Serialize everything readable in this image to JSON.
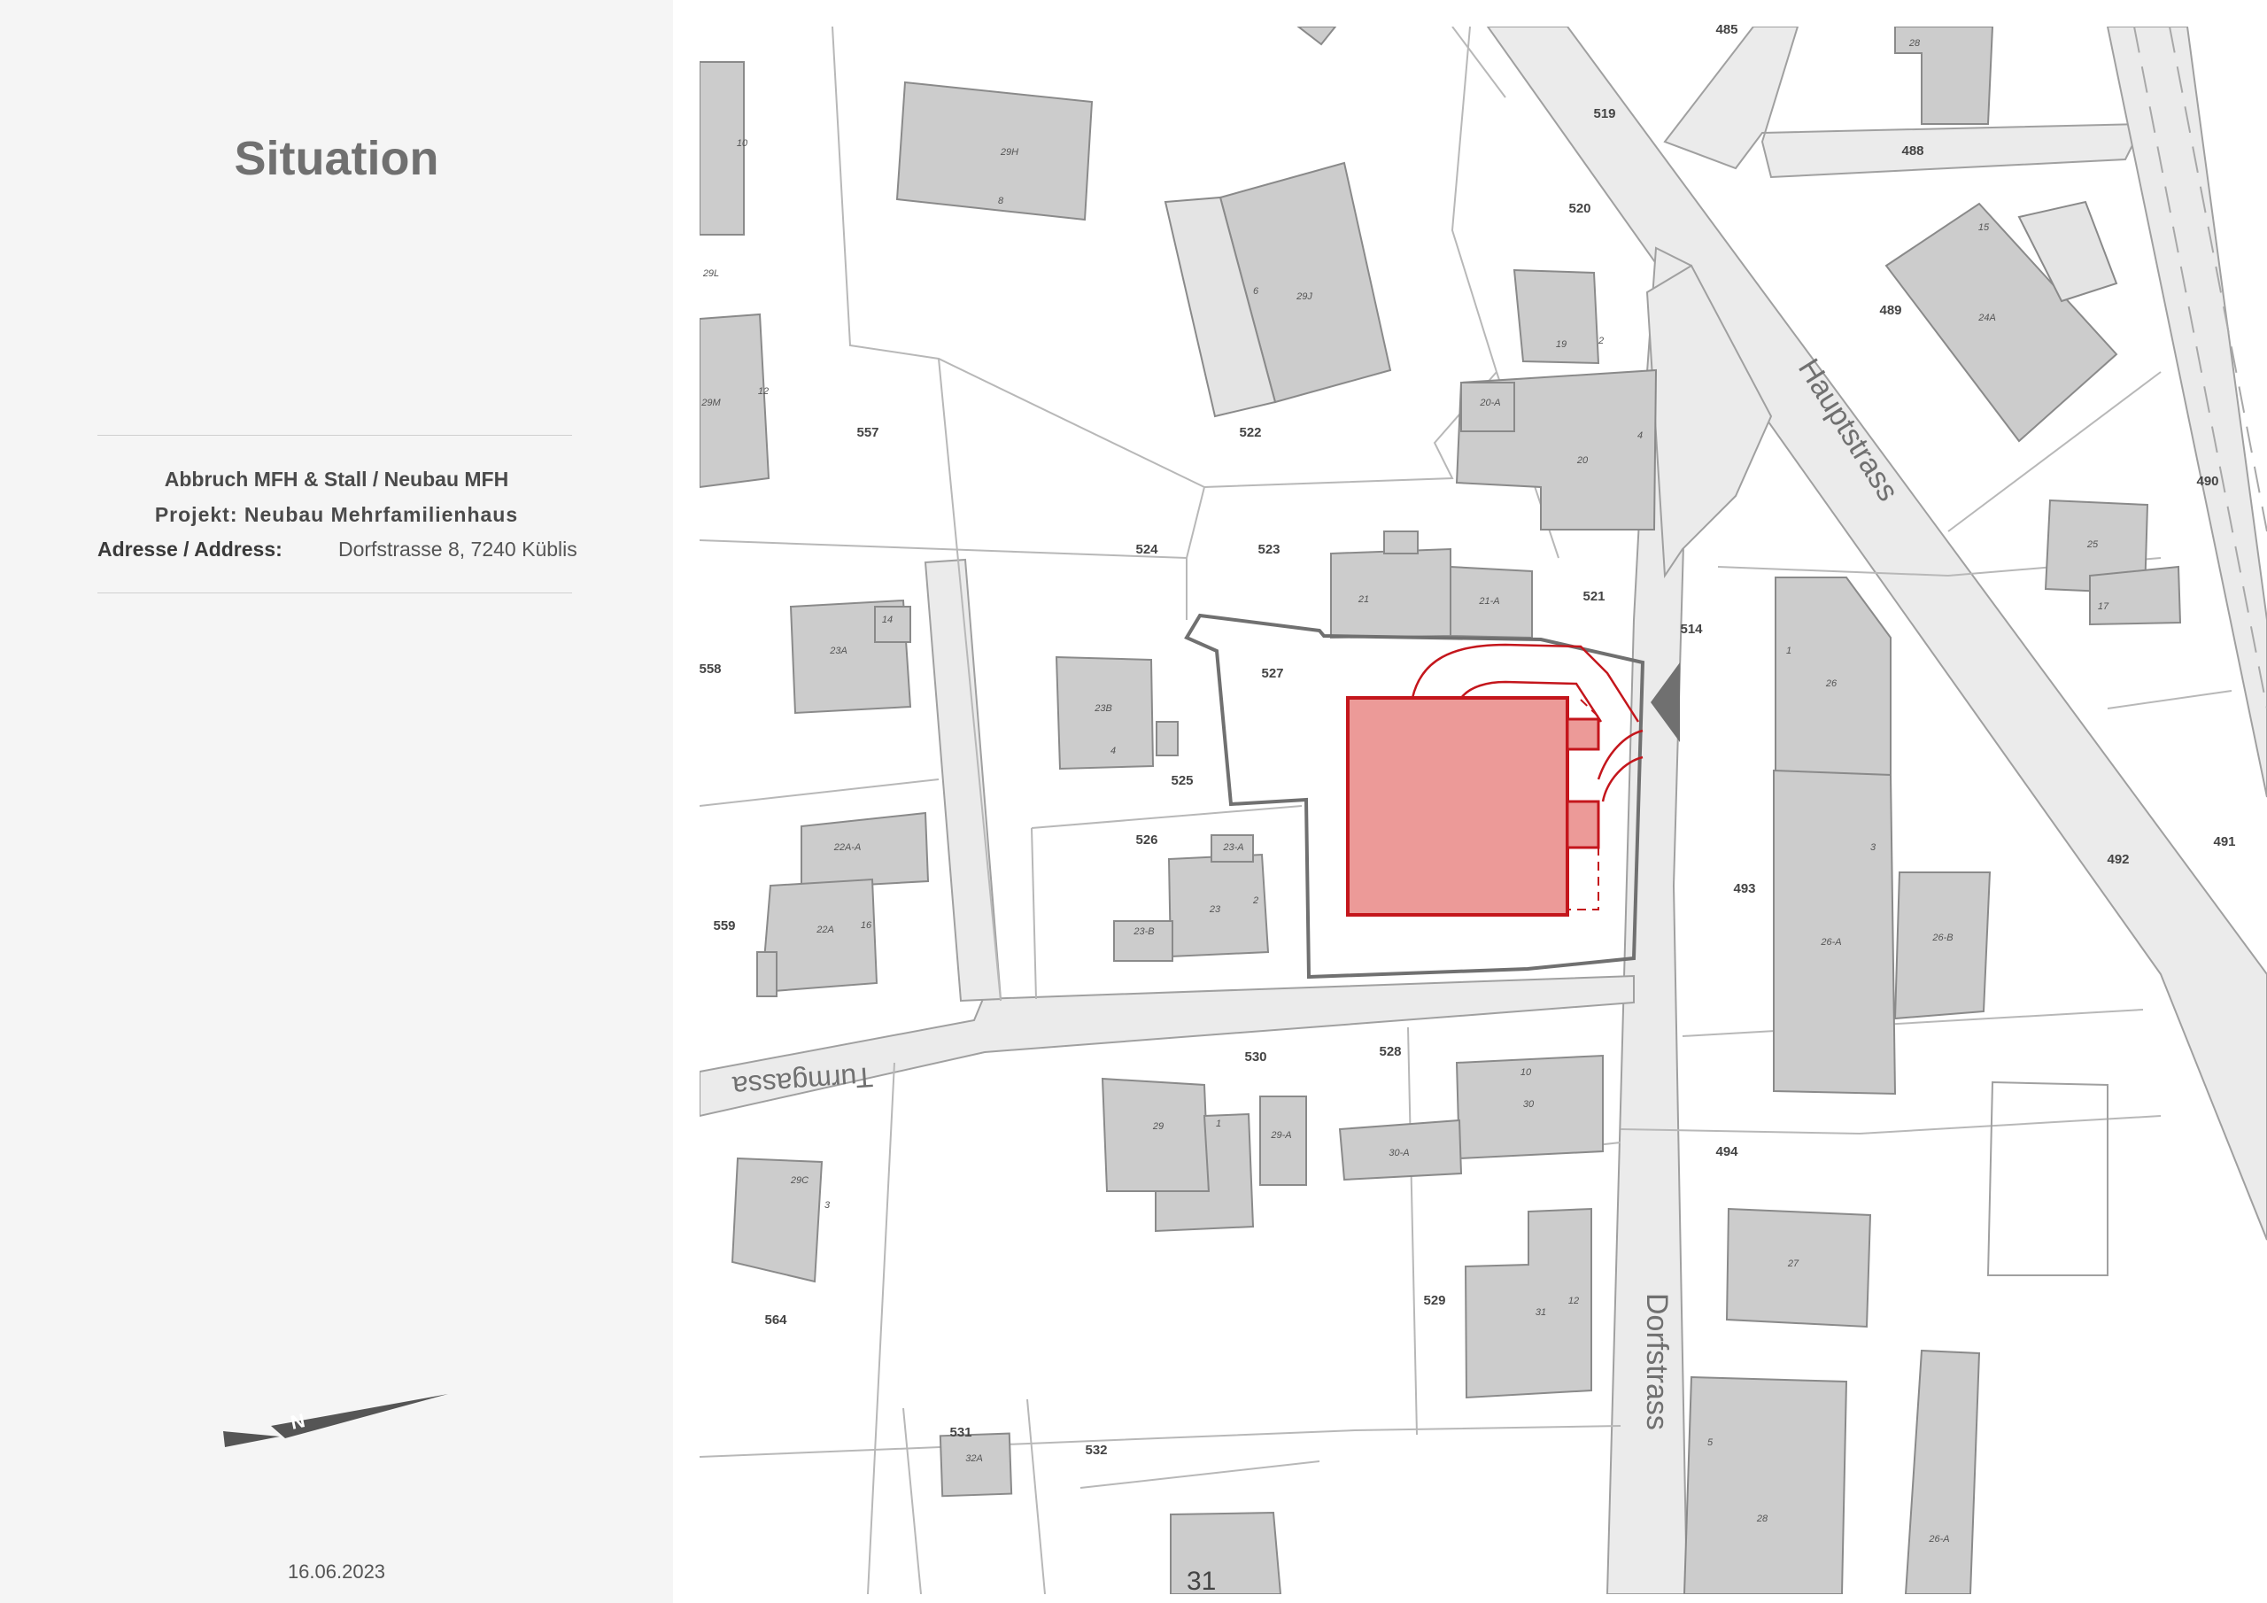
{
  "sidebar": {
    "title": "Situation",
    "line1": "Abbruch MFH & Stall / Neubau MFH",
    "line2": "Projekt: Neubau Mehrfamilienhaus",
    "address_label": "Adresse / Address:",
    "address_value": "Dorfstrasse 8, 7240 Küblis",
    "north_label": "N",
    "date": "16.06.2023"
  },
  "map": {
    "colors": {
      "building": "#cccccc",
      "building_stroke": "#8a8a8a",
      "road": "#e8e8e8",
      "parcel_line": "#b5b5b5",
      "project_fill": "#ec9a98",
      "project_stroke": "#c4161c",
      "site_boundary": "#707070"
    },
    "streets": {
      "hauptstrasse": "Hauptstrass",
      "dorfstrasse": "Dorfstrass",
      "turmgasse": "Turmgassa"
    },
    "parcels": [
      "485",
      "519",
      "488",
      "520",
      "489",
      "557",
      "522",
      "524",
      "523",
      "521",
      "514",
      "490",
      "558",
      "527",
      "525",
      "526",
      "559",
      "491",
      "492",
      "493",
      "530",
      "528",
      "494",
      "564",
      "529",
      "531",
      "532"
    ],
    "building_labels": [
      "28",
      "29H",
      "8",
      "10",
      "29L",
      "29M",
      "12",
      "6",
      "29J",
      "19",
      "2",
      "20-A",
      "20",
      "4",
      "15",
      "24A",
      "25",
      "17",
      "21",
      "21-A",
      "23A",
      "14",
      "23B",
      "4",
      "1",
      "26",
      "3",
      "22A-A",
      "22A",
      "16",
      "23-A",
      "23",
      "2",
      "23-B",
      "26-A",
      "26-B",
      "10",
      "30",
      "29",
      "1",
      "29-A",
      "30-A",
      "29C",
      "3",
      "27",
      "31",
      "12",
      "32A",
      "5",
      "28",
      "26-A"
    ],
    "house_number": "31"
  }
}
